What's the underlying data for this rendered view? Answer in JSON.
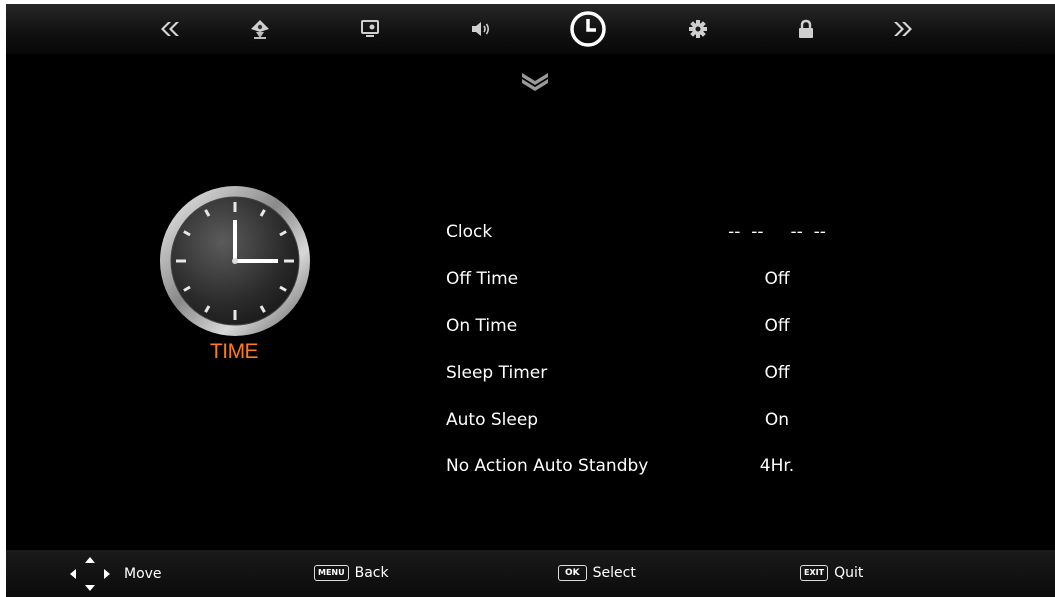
{
  "top_tabs": [
    {
      "icon": "double-chevron-left-icon"
    },
    {
      "icon": "satellite-dish-icon"
    },
    {
      "icon": "picture-icon"
    },
    {
      "icon": "speaker-icon"
    },
    {
      "icon": "clock-icon",
      "active": true
    },
    {
      "icon": "gear-icon"
    },
    {
      "icon": "lock-icon"
    },
    {
      "icon": "double-chevron-right-icon"
    }
  ],
  "section": {
    "title": "TIME",
    "accent_color": "#ff7a1a"
  },
  "menu": [
    {
      "label": "Clock",
      "value": "--  --     --  --"
    },
    {
      "label": "Off Time",
      "value": "Off"
    },
    {
      "label": "On Time",
      "value": "Off"
    },
    {
      "label": "Sleep Timer",
      "value": "Off"
    },
    {
      "label": "Auto Sleep",
      "value": "On"
    },
    {
      "label": "No Action Auto Standby",
      "value": "4Hr."
    }
  ],
  "footer": {
    "move": {
      "label": "Move"
    },
    "back": {
      "key": "MENU",
      "label": "Back"
    },
    "select": {
      "key": "OK",
      "label": "Select"
    },
    "quit": {
      "key": "EXIT",
      "label": "Quit"
    }
  }
}
